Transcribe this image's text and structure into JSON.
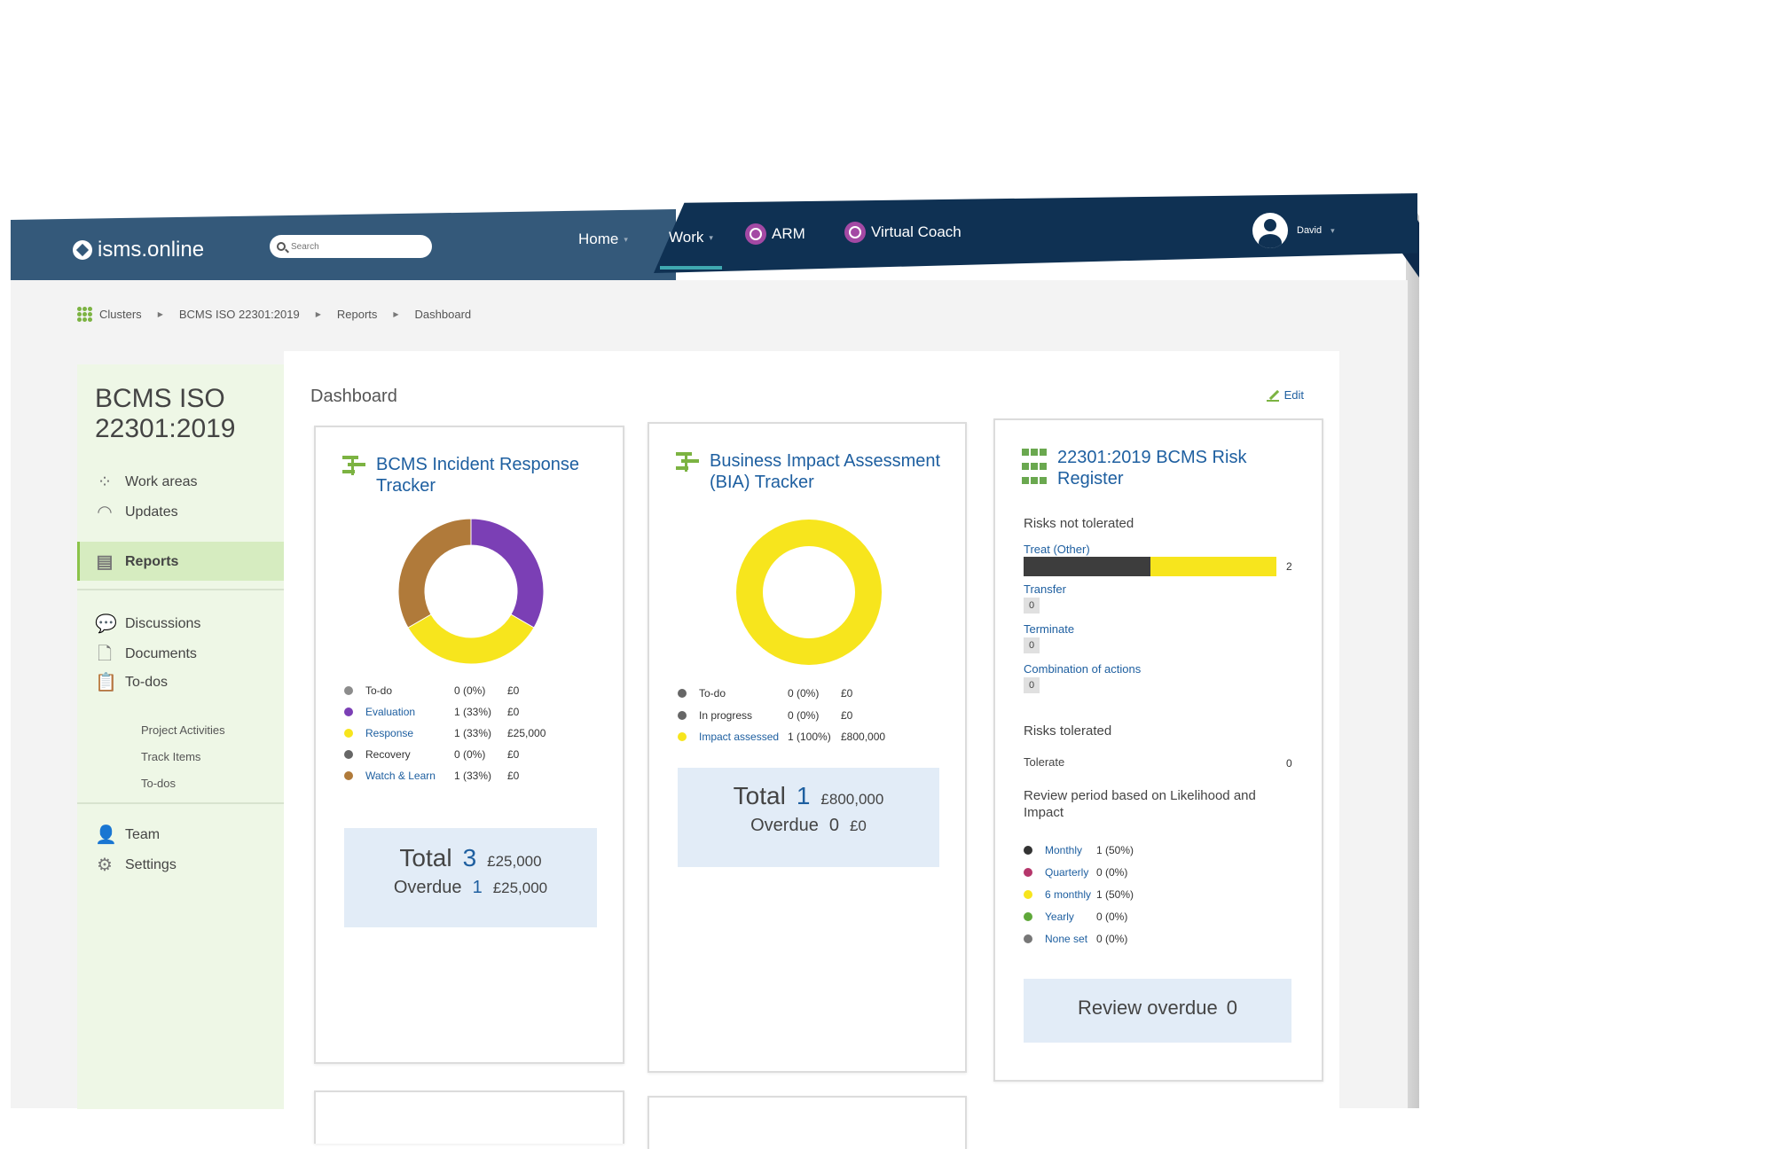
{
  "app": {
    "logo": "isms.online",
    "search_placeholder": "Search",
    "nav": [
      {
        "label": "Home",
        "caret": "▾"
      },
      {
        "label": "Work",
        "caret": "▾"
      },
      {
        "label": "ARM"
      },
      {
        "label": "Virtual Coach"
      }
    ],
    "user": {
      "name": "David",
      "caret": "▾"
    }
  },
  "breadcrumb": [
    "Clusters",
    "BCMS ISO 22301:2019",
    "Reports",
    "Dashboard"
  ],
  "breadcrumb_sep": "▶",
  "sidebar": {
    "title": "BCMS ISO 22301:2019",
    "items": [
      {
        "label": "Work areas",
        "icon": "work-areas-icon"
      },
      {
        "label": "Updates",
        "icon": "wifi-icon"
      },
      {
        "label": "Reports",
        "icon": "report-icon",
        "active": true
      },
      {
        "label": "Discussions",
        "icon": "chat-icon"
      },
      {
        "label": "Documents",
        "icon": "document-icon"
      },
      {
        "label": "To-dos",
        "icon": "clipboard-icon"
      },
      {
        "label": "Team",
        "icon": "team-icon"
      },
      {
        "label": "Settings",
        "icon": "gear-icon"
      }
    ],
    "todo_subitems": [
      "Project Activities",
      "Track Items",
      "To-dos"
    ]
  },
  "main": {
    "title": "Dashboard",
    "edit_label": "Edit"
  },
  "cards": {
    "incident": {
      "title": "BCMS Incident Response Tracker",
      "legend": [
        {
          "label": "To-do",
          "count": "0 (0%)",
          "amount": "£0",
          "color": "#8c8c8c",
          "link": false
        },
        {
          "label": "Evaluation",
          "count": "1 (33%)",
          "amount": "£0",
          "color": "#7b3fb5",
          "link": true
        },
        {
          "label": "Response",
          "count": "1 (33%)",
          "amount": "£25,000",
          "color": "#f7e51d",
          "link": true
        },
        {
          "label": "Recovery",
          "count": "0 (0%)",
          "amount": "£0",
          "color": "#666666",
          "link": false
        },
        {
          "label": "Watch & Learn",
          "count": "1 (33%)",
          "amount": "£0",
          "color": "#b07a3a",
          "link": true
        }
      ],
      "total_label": "Total",
      "total_value": "3",
      "total_amount": "£25,000",
      "overdue_label": "Overdue",
      "overdue_value": "1",
      "overdue_amount": "£25,000"
    },
    "bia": {
      "title": "Business Impact Assessment (BIA) Tracker",
      "legend": [
        {
          "label": "To-do",
          "count": "0 (0%)",
          "amount": "£0",
          "color": "#666666",
          "link": false
        },
        {
          "label": "In progress",
          "count": "0 (0%)",
          "amount": "£0",
          "color": "#666666",
          "link": false
        },
        {
          "label": "Impact assessed",
          "count": "1 (100%)",
          "amount": "£800,000",
          "color": "#f7e51d",
          "link": true
        }
      ],
      "total_label": "Total",
      "total_value": "1",
      "total_amount": "£800,000",
      "overdue_label": "Overdue",
      "overdue_value": "0",
      "overdue_amount": "£0"
    },
    "risk": {
      "title": "22301:2019 BCMS Risk Register",
      "not_tolerated_label": "Risks not tolerated",
      "not_tolerated": [
        {
          "label": "Treat (Other)",
          "value": "2",
          "dark_share": 0.5,
          "yellow_share": 0.5
        },
        {
          "label": "Transfer",
          "value": "0"
        },
        {
          "label": "Terminate",
          "value": "0"
        },
        {
          "label": "Combination of actions",
          "value": "0"
        }
      ],
      "tolerated_label": "Risks tolerated",
      "tolerate_label": "Tolerate",
      "tolerate_value": "0",
      "review_heading": "Review period based on Likelihood and Impact",
      "review": [
        {
          "label": "Monthly",
          "count": "1 (50%)",
          "color": "#333333"
        },
        {
          "label": "Quarterly",
          "count": "0 (0%)",
          "color": "#b5366b"
        },
        {
          "label": "6 monthly",
          "count": "1 (50%)",
          "color": "#f7e51d"
        },
        {
          "label": "Yearly",
          "count": "0 (0%)",
          "color": "#5fa83a"
        },
        {
          "label": "None set",
          "count": "0 (0%)",
          "color": "#777777"
        }
      ],
      "review_overdue_label": "Review overdue",
      "review_overdue_value": "0"
    }
  },
  "chart_data": [
    {
      "type": "pie",
      "title": "BCMS Incident Response Tracker",
      "categories": [
        "To-do",
        "Evaluation",
        "Response",
        "Recovery",
        "Watch & Learn"
      ],
      "values": [
        0,
        1,
        1,
        0,
        1
      ],
      "colors": [
        "#8c8c8c",
        "#7b3fb5",
        "#f7e51d",
        "#666666",
        "#b07a3a"
      ],
      "donut": true
    },
    {
      "type": "pie",
      "title": "Business Impact Assessment (BIA) Tracker",
      "categories": [
        "To-do",
        "In progress",
        "Impact assessed"
      ],
      "values": [
        0,
        0,
        1
      ],
      "colors": [
        "#666666",
        "#666666",
        "#f7e51d"
      ],
      "donut": true
    }
  ]
}
